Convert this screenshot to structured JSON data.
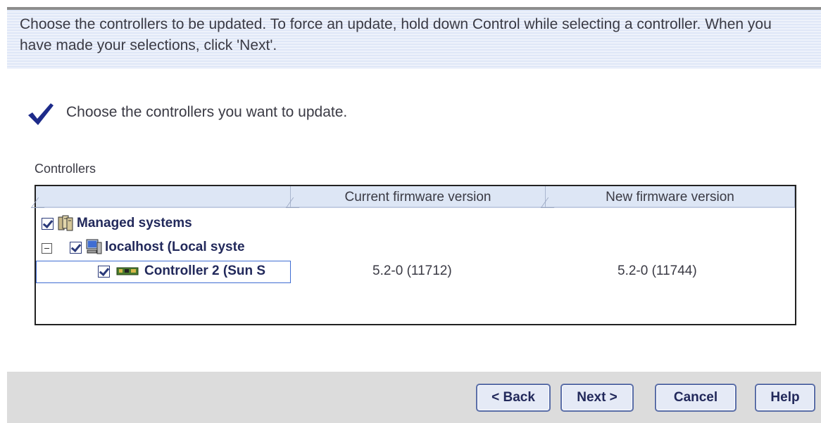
{
  "instruction": "Choose the controllers to be updated.  To force an update, hold down Control while selecting a controller.  When you have made your selections, click 'Next'.",
  "step": {
    "text": "Choose the controllers you want to update.",
    "icon": "checkmark-icon"
  },
  "controllers_label": "Controllers",
  "table": {
    "columns": [
      "",
      "Current firmware version",
      "New firmware version"
    ],
    "rows": [
      {
        "label": "Managed systems",
        "checked": true,
        "icon": "servers-icon",
        "current": "",
        "new": ""
      },
      {
        "label": "localhost (Local syste",
        "checked": true,
        "expanded": true,
        "icon": "monitor-icon",
        "current": "",
        "new": ""
      },
      {
        "label": "Controller 2 (Sun S",
        "checked": true,
        "selected": true,
        "icon": "controller-card-icon",
        "current": "5.2-0 (11712)",
        "new": "5.2-0 (11744)"
      }
    ]
  },
  "buttons": {
    "back": "< Back",
    "next": "Next >",
    "cancel": "Cancel",
    "help": "Help"
  },
  "colors": {
    "accent": "#22295b",
    "header": "#dde6f5",
    "footer": "#dcdcdc"
  }
}
